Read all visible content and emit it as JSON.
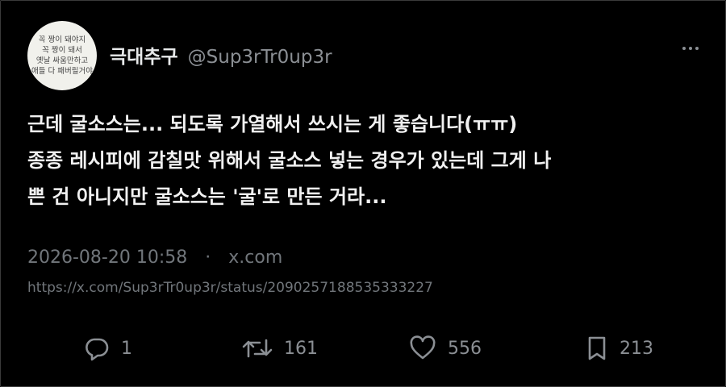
{
  "avatar": {
    "lines": [
      "꼭 짱이 돼야지",
      "꼭 짱이 돼서",
      "옛날 싸움만하고",
      "애들 다 패버릴거야"
    ]
  },
  "user": {
    "display_name": "극대추구",
    "handle": "@Sup3rTr0up3r"
  },
  "tweet": {
    "text": "근데 굴소스는... 되도록 가열해서 쓰시는 게 좋습니다(ㅠㅠ)\n종종 레시피에 감칠맛 위해서 굴소스 넣는 경우가 있는데 그게 나\n쁜 건 아니지만 굴소스는 '굴'로 만든 거라...",
    "timestamp": "2026-08-20 10:58",
    "separator": "·",
    "source": "x.com",
    "url": "https://x.com/Sup3rTr0up3r/status/2090257188535333227"
  },
  "actions": {
    "replies": "1",
    "retweets": "161",
    "likes": "556",
    "bookmarks": "213"
  },
  "icons": {
    "more": "more-dots-icon",
    "reply": "reply-icon",
    "retweet": "retweet-icon",
    "like": "heart-icon",
    "bookmark": "bookmark-icon"
  },
  "colors": {
    "background": "#000000",
    "text": "#e7e9ea",
    "muted": "#71767b"
  }
}
